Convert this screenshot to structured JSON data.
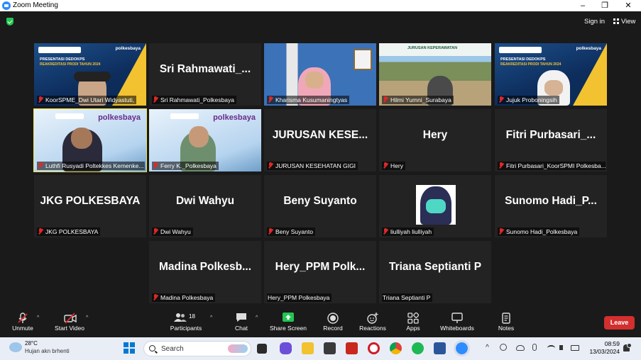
{
  "window": {
    "title": "Zoom Meeting",
    "minimize": "–",
    "restore": "❐",
    "close": "✕"
  },
  "meeting_bar": {
    "sign_in": "Sign in",
    "view": "View"
  },
  "tiles": [
    {
      "label": "KoorSPME_Dwi Utari Widyastuti,",
      "big_name": "",
      "video": "slide",
      "muted": true,
      "active": false
    },
    {
      "label": "Sri Rahmawati_Polkesbaya",
      "big_name": "Sri  Rahmawati_...",
      "video": "",
      "muted": true,
      "active": false
    },
    {
      "label": "Kharisma Kusumaningtyas",
      "big_name": "",
      "video": "hijab-blue",
      "muted": true,
      "active": false
    },
    {
      "label": "Hilmi Yumni_Surabaya",
      "big_name": "",
      "video": "campus",
      "muted": true,
      "active": false
    },
    {
      "label": "Jujuk Proboningsih",
      "big_name": "",
      "video": "slide-hijab",
      "muted": true,
      "active": false
    },
    {
      "label": "Luthfi Rusyadi Poltekkes Kemenke...",
      "big_name": "",
      "video": "banner-man",
      "muted": true,
      "active": true
    },
    {
      "label": "Ferry K._Polkesbaya",
      "big_name": "",
      "video": "banner-man2",
      "muted": true,
      "active": false
    },
    {
      "label": "JURUSAN KESEHATAN GIGI",
      "big_name": "JURUSAN  KESE...",
      "video": "",
      "muted": true,
      "active": false
    },
    {
      "label": "Hery",
      "big_name": "Hery",
      "video": "",
      "muted": true,
      "active": false
    },
    {
      "label": "Fitri Purbasari_KoorSPMI Polkesba...",
      "big_name": "Fitri  Purbasari_...",
      "video": "",
      "muted": true,
      "active": false
    },
    {
      "label": "JKG POLKESBAYA",
      "big_name": "JKG  POLKESBAYA",
      "video": "",
      "muted": true,
      "active": false
    },
    {
      "label": "Dwi Wahyu",
      "big_name": "Dwi  Wahyu",
      "video": "",
      "muted": true,
      "active": false
    },
    {
      "label": "Beny Suyanto",
      "big_name": "Beny  Suyanto",
      "video": "",
      "muted": true,
      "active": false
    },
    {
      "label": "liulliyah liulliyah",
      "big_name": "",
      "video": "mask",
      "muted": true,
      "active": false
    },
    {
      "label": "Sunomo Hadi_Polkesbaya",
      "big_name": "Sunomo  Hadi_P...",
      "video": "",
      "muted": true,
      "active": false
    },
    {
      "label": "Madina Polkesbaya",
      "big_name": "Madina  Polkesb...",
      "video": "",
      "muted": true,
      "active": false
    },
    {
      "label": "Hery_PPM Polkesbaya",
      "big_name": "Hery_PPM  Polk...",
      "video": "",
      "muted": false,
      "active": false
    },
    {
      "label": "Triana Septianti P",
      "big_name": "Triana  Septianti  P",
      "video": "",
      "muted": false,
      "active": false
    }
  ],
  "slide_text": {
    "line1": "PRESENTASI DEDOKPS",
    "line2": "REAKREDITASI PRODI TAHUN 2024",
    "brand": "polkesbaya",
    "campus_sign": "JURUSAN KEPERAWATAN"
  },
  "toolbar": {
    "unmute": "Unmute",
    "start_video": "Start Video",
    "participants": "Participants",
    "participants_count": "18",
    "chat": "Chat",
    "share_screen": "Share Screen",
    "record": "Record",
    "reactions": "Reactions",
    "apps": "Apps",
    "whiteboards": "Whiteboards",
    "notes": "Notes",
    "leave": "Leave"
  },
  "taskbar": {
    "temperature": "28°C",
    "weather_desc": "Hujan akn brhenti",
    "search_placeholder": "Search",
    "time": "08:59",
    "date": "13/03/2024",
    "tray_chevron": "^"
  },
  "colors": {
    "active_speaker": "#f0e442",
    "share_green": "#23c552",
    "leave_red": "#d32f2f",
    "muted_red": "#e02828"
  }
}
